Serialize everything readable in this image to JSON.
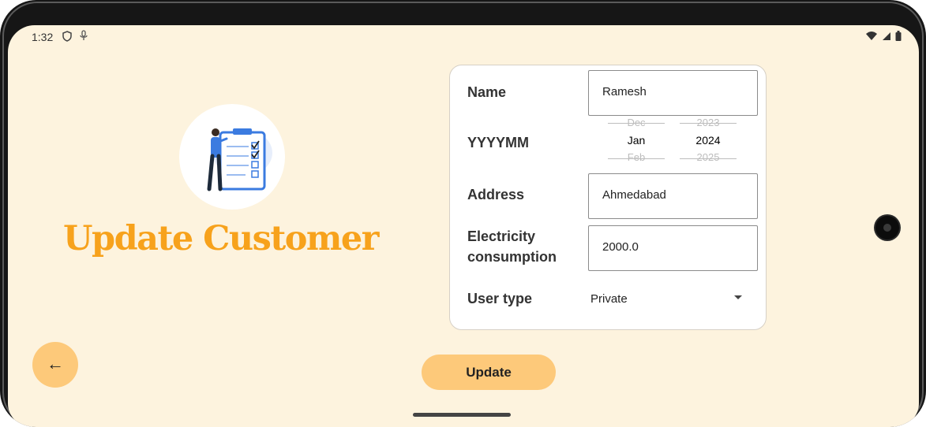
{
  "status_bar": {
    "time": "1:32",
    "icons_left": [
      "shield-icon",
      "mic-icon"
    ],
    "icons_right": [
      "wifi-icon",
      "signal-icon",
      "battery-icon"
    ]
  },
  "page": {
    "title": "Update Customer",
    "illustration": "clipboard-checklist-illustration"
  },
  "form": {
    "name_label": "Name",
    "name_value": "Ramesh",
    "date_label": "YYYYMM",
    "month_picker": {
      "prev": "Dec",
      "selected": "Jan",
      "next": "Feb"
    },
    "year_picker": {
      "prev": "2023",
      "selected": "2024",
      "next": "2025"
    },
    "address_label": "Address",
    "address_value": "Ahmedabad",
    "consumption_label_line1": "Electricity",
    "consumption_label_line2": "consumption",
    "consumption_value": "2000.0",
    "user_type_label": "User type",
    "user_type_selected": "Private"
  },
  "buttons": {
    "update_label": "Update",
    "back_icon": "arrow-left-icon",
    "back_glyph": "←"
  },
  "colors": {
    "background": "#fdf3de",
    "accent": "#f7a21c",
    "button": "#fdc97a"
  }
}
